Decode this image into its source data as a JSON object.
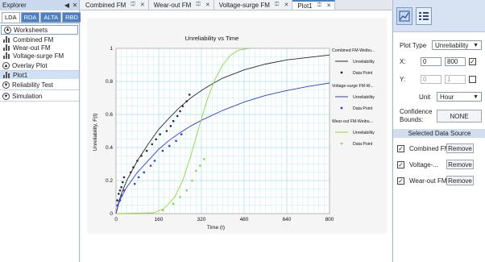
{
  "explorer": {
    "title": "Explorer",
    "tabs": [
      "LDA",
      "RDA",
      "ALTA",
      "RBD"
    ],
    "worksheets_label": "Worksheets",
    "worksheets": [
      "Combined FM",
      "Wear-out FM",
      "Voltage-surge FM"
    ],
    "overlay_label": "Overlay Plot",
    "overlay_items": [
      "Plot1"
    ],
    "reliability_test_label": "Reliability Test",
    "simulation_label": "Simulation"
  },
  "doc_tabs": [
    {
      "label": "Combined FM",
      "active": false
    },
    {
      "label": "Wear-out FM",
      "active": false
    },
    {
      "label": "Voltage-surge FM",
      "active": false
    },
    {
      "label": "Plot1",
      "active": true
    }
  ],
  "panel": {
    "plot_type_label": "Plot Type",
    "plot_type_value": "Unreliability",
    "x_label": "X:",
    "x_min": "0",
    "x_max": "800",
    "x_checked": true,
    "y_label": "Y:",
    "y_min": "0",
    "y_max": "1",
    "y_checked": false,
    "unit_label": "Unit",
    "unit_value": "Hour",
    "confidence_label_1": "Confidence",
    "confidence_label_2": "Bounds:",
    "confidence_value": "NONE",
    "selected_source_label": "Selected Data Source",
    "sources": [
      {
        "name": "Combined FM",
        "checked": true,
        "button": "Remove"
      },
      {
        "name": "Voltage-...",
        "checked": true,
        "button": "Remove"
      },
      {
        "name": "Wear-out FM",
        "checked": true,
        "button": "Remove"
      }
    ]
  },
  "chart_data": {
    "type": "line",
    "title": "Unreliability vs Time",
    "xlabel": "Time (t)",
    "ylabel": "Unreliability, F(t)",
    "xlim": [
      0,
      800
    ],
    "ylim": [
      0,
      1
    ],
    "xticks": [
      "0",
      "160",
      "320",
      "480",
      "640",
      "800"
    ],
    "yticks": [
      "0",
      "0.2",
      "0.4",
      "0.6",
      "0.8",
      "1"
    ],
    "grid": true,
    "legend_position": "right",
    "legend": [
      {
        "group": "Combined FM-Weibu...",
        "line_label": "Unreliability",
        "point_label": "Data Point"
      },
      {
        "group": "Voltage-surge FM-W...",
        "line_label": "Unreliability",
        "point_label": "Data Point"
      },
      {
        "group": "Wear-out FM-Weibu...",
        "line_label": "Unreliability",
        "point_label": "Data Point"
      }
    ],
    "colors": {
      "combined": "#2b2b2b",
      "voltage": "#2e3bd8",
      "wearout": "#8ed63a"
    },
    "series": [
      {
        "key": "combined",
        "curve": [
          [
            0,
            0
          ],
          [
            10,
            0.07
          ],
          [
            20,
            0.12
          ],
          [
            40,
            0.2
          ],
          [
            80,
            0.32
          ],
          [
            120,
            0.42
          ],
          [
            160,
            0.51
          ],
          [
            200,
            0.58
          ],
          [
            240,
            0.645
          ],
          [
            280,
            0.7
          ],
          [
            320,
            0.745
          ],
          [
            360,
            0.785
          ],
          [
            400,
            0.82
          ],
          [
            480,
            0.87
          ],
          [
            560,
            0.905
          ],
          [
            640,
            0.93
          ],
          [
            720,
            0.945
          ],
          [
            800,
            0.96
          ]
        ],
        "points": [
          [
            5,
            0.08
          ],
          [
            10,
            0.12
          ],
          [
            15,
            0.14
          ],
          [
            20,
            0.16
          ],
          [
            25,
            0.19
          ],
          [
            30,
            0.22
          ],
          [
            55,
            0.25
          ],
          [
            65,
            0.28
          ],
          [
            80,
            0.32
          ],
          [
            95,
            0.35
          ],
          [
            115,
            0.38
          ],
          [
            135,
            0.42
          ],
          [
            150,
            0.45
          ],
          [
            165,
            0.48
          ],
          [
            190,
            0.5
          ],
          [
            205,
            0.53
          ],
          [
            215,
            0.56
          ],
          [
            230,
            0.59
          ],
          [
            240,
            0.62
          ],
          [
            250,
            0.65
          ],
          [
            265,
            0.68
          ],
          [
            275,
            0.72
          ]
        ]
      },
      {
        "key": "voltage",
        "curve": [
          [
            0,
            0
          ],
          [
            10,
            0.06
          ],
          [
            20,
            0.1
          ],
          [
            40,
            0.16
          ],
          [
            80,
            0.25
          ],
          [
            120,
            0.32
          ],
          [
            160,
            0.39
          ],
          [
            200,
            0.445
          ],
          [
            240,
            0.49
          ],
          [
            280,
            0.53
          ],
          [
            320,
            0.565
          ],
          [
            400,
            0.625
          ],
          [
            480,
            0.675
          ],
          [
            560,
            0.715
          ],
          [
            640,
            0.745
          ],
          [
            720,
            0.77
          ],
          [
            800,
            0.79
          ]
        ],
        "points": [
          [
            5,
            0.05
          ],
          [
            15,
            0.08
          ],
          [
            22,
            0.11
          ],
          [
            30,
            0.14
          ],
          [
            70,
            0.18
          ],
          [
            85,
            0.22
          ],
          [
            105,
            0.25
          ],
          [
            130,
            0.29
          ],
          [
            145,
            0.32
          ],
          [
            175,
            0.38
          ],
          [
            200,
            0.41
          ],
          [
            225,
            0.44
          ],
          [
            245,
            0.48
          ]
        ]
      },
      {
        "key": "wearout",
        "curve": [
          [
            0,
            0
          ],
          [
            140,
            0.005
          ],
          [
            180,
            0.03
          ],
          [
            220,
            0.1
          ],
          [
            250,
            0.2
          ],
          [
            280,
            0.35
          ],
          [
            310,
            0.52
          ],
          [
            340,
            0.68
          ],
          [
            370,
            0.81
          ],
          [
            400,
            0.9
          ],
          [
            430,
            0.96
          ],
          [
            460,
            0.99
          ],
          [
            500,
            1.0
          ]
        ],
        "points": [
          [
            175,
            0.02
          ],
          [
            215,
            0.06
          ],
          [
            240,
            0.1
          ],
          [
            265,
            0.14
          ],
          [
            285,
            0.2
          ],
          [
            300,
            0.26
          ],
          [
            315,
            0.29
          ],
          [
            330,
            0.33
          ]
        ]
      }
    ]
  }
}
